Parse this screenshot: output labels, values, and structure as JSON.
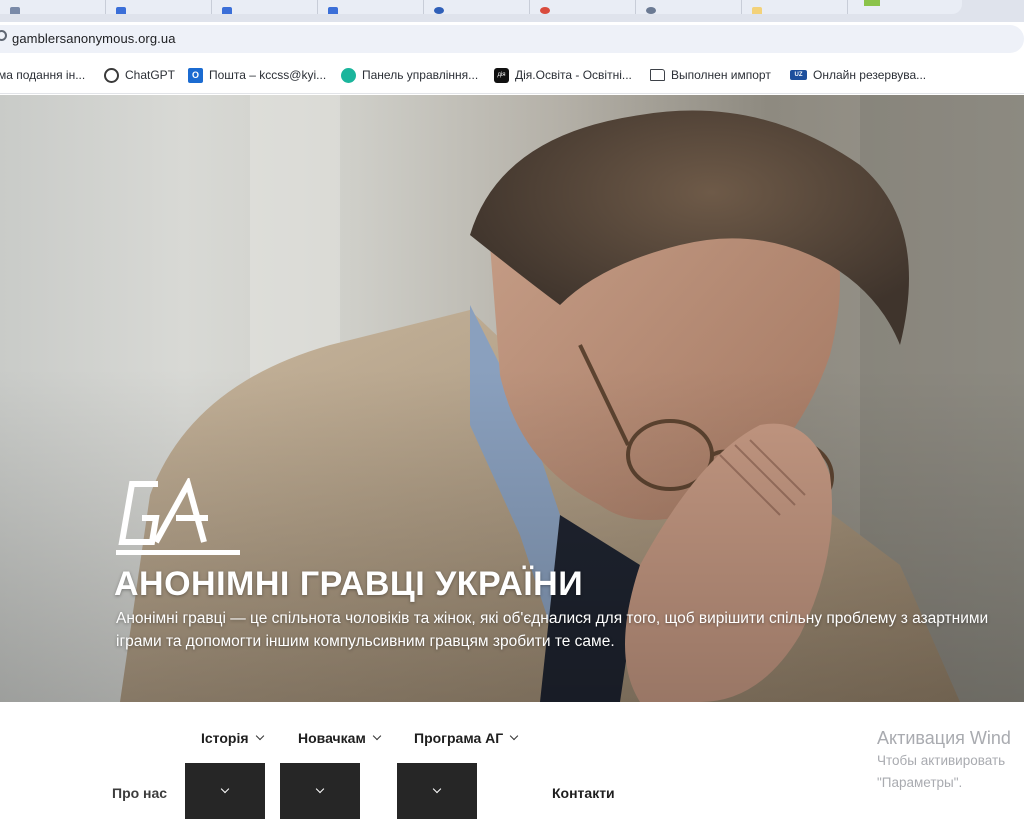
{
  "browser": {
    "address": "gamblersanonymous.org.ua",
    "bookmarks": [
      {
        "label": "ма подання ін...",
        "icon": "none"
      },
      {
        "label": "ChatGPT",
        "icon": "chatgpt-icon"
      },
      {
        "label": "Пошта – kccss@kyi...",
        "icon": "outlook-icon"
      },
      {
        "label": "Панель управління...",
        "icon": "graduation-cap-icon"
      },
      {
        "label": "Дія.Освіта - Освітні...",
        "icon": "diia-icon"
      },
      {
        "label": "Выполнен импорт",
        "icon": "folder-icon"
      },
      {
        "label": "Онлайн резервува...",
        "icon": "uz-icon"
      }
    ]
  },
  "hero": {
    "title": "АНОНІМНІ ГРАВЦІ УКРАЇНИ",
    "description": "Анонімні гравці — це спільнота чоловіків та жінок, які об'єдналися для того, щоб вирішити спільну проблему з азартними іграми та допомогти іншим компульсивним гравцям зробити те саме.",
    "logo_text": "GA"
  },
  "nav": {
    "history": "Історія",
    "newcomers": "Новачкам",
    "program": "Програма АГ",
    "about": "Про нас",
    "contacts": "Контакти"
  },
  "windows_activation": {
    "line1": "Активация Wind",
    "line2": "Чтобы активировать",
    "line3": "\"Параметры\"."
  },
  "colors": {
    "dark_button": "#262626",
    "activation_text": "#a9abb0"
  }
}
